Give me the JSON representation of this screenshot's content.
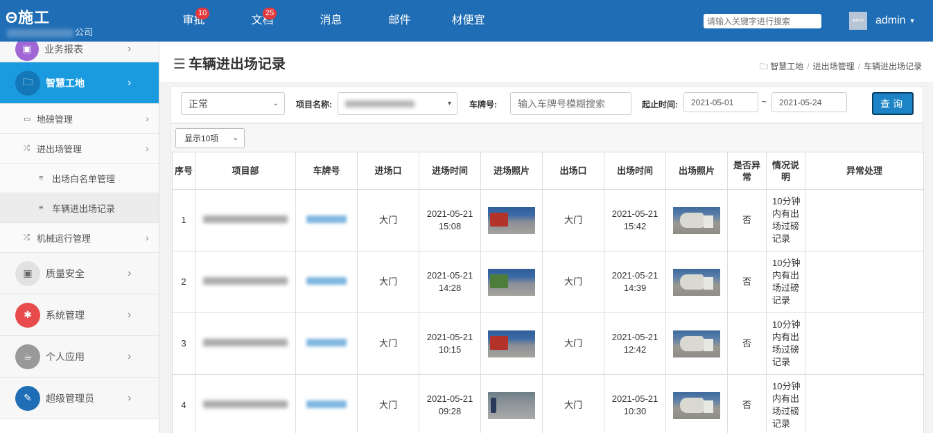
{
  "topbar": {
    "brand": "Θ施工",
    "company_suffix": "公司",
    "nav": [
      {
        "label": "审批",
        "badge": "10"
      },
      {
        "label": "文档",
        "badge": "25"
      },
      {
        "label": "消息",
        "badge": ""
      },
      {
        "label": "邮件",
        "badge": ""
      },
      {
        "label": "材便宜",
        "badge": ""
      }
    ],
    "search_placeholder": "请输入关键字进行搜索",
    "avatar_text": "admin",
    "username": "admin"
  },
  "sidebar": {
    "menus": [
      {
        "label": "业务报表",
        "icon": "briefcase-icon",
        "color": "#a066d3"
      },
      {
        "label": "智慧工地",
        "icon": "folder-icon",
        "color": "#1478b8"
      },
      {
        "label": "质量安全",
        "icon": "briefcase-icon",
        "color": "#e2e2e2"
      },
      {
        "label": "系统管理",
        "icon": "gear-icon",
        "color": "#e84b4b"
      },
      {
        "label": "个人应用",
        "icon": "coffee-icon",
        "color": "#999999"
      },
      {
        "label": "超级管理员",
        "icon": "wrench-icon",
        "color": "#1f6db5"
      }
    ],
    "subs": [
      {
        "label": "地磅管理",
        "icon": "laptop-icon"
      },
      {
        "label": "进出场管理",
        "icon": "shuffle-icon"
      },
      {
        "label": "出场白名单管理",
        "icon": "list-icon"
      },
      {
        "label": "车辆进出场记录",
        "icon": "list-icon"
      },
      {
        "label": "机械运行管理",
        "icon": "shuffle-icon"
      }
    ]
  },
  "page": {
    "title": "车辆进出场记录",
    "breadcrumb": [
      "智慧工地",
      "进出场管理",
      "车辆进出场记录"
    ]
  },
  "filter": {
    "status_value": "正常",
    "project_label": "项目名称:",
    "plate_label": "车牌号:",
    "plate_placeholder": "输入车牌号模糊搜索",
    "time_label": "起止时间:",
    "start_date": "2021-05-01",
    "range_sep": "~",
    "end_date": "2021-05-24",
    "query_button": "查询"
  },
  "table": {
    "page_size": "显示10项",
    "headers": [
      "序号",
      "项目部",
      "车牌号",
      "进场口",
      "进场时间",
      "进场照片",
      "出场口",
      "出场时间",
      "出场照片",
      "是否异常",
      "情况说明",
      "异常处理"
    ],
    "rows": [
      {
        "no": "1",
        "gate_in": "大门",
        "time_in": "2021-05-21 15:08",
        "gate_out": "大门",
        "time_out": "2021-05-21 15:42",
        "abnormal": "否",
        "note": "10分钟内有出场过磅记录",
        "handling": ""
      },
      {
        "no": "2",
        "gate_in": "大门",
        "time_in": "2021-05-21 14:28",
        "gate_out": "大门",
        "time_out": "2021-05-21 14:39",
        "abnormal": "否",
        "note": "10分钟内有出场过磅记录",
        "handling": ""
      },
      {
        "no": "3",
        "gate_in": "大门",
        "time_in": "2021-05-21 10:15",
        "gate_out": "大门",
        "time_out": "2021-05-21 12:42",
        "abnormal": "否",
        "note": "10分钟内有出场过磅记录",
        "handling": ""
      },
      {
        "no": "4",
        "gate_in": "大门",
        "time_in": "2021-05-21 09:28",
        "gate_out": "大门",
        "time_out": "2021-05-21 10:30",
        "abnormal": "否",
        "note": "10分钟内有出场过磅记录",
        "handling": ""
      }
    ]
  }
}
